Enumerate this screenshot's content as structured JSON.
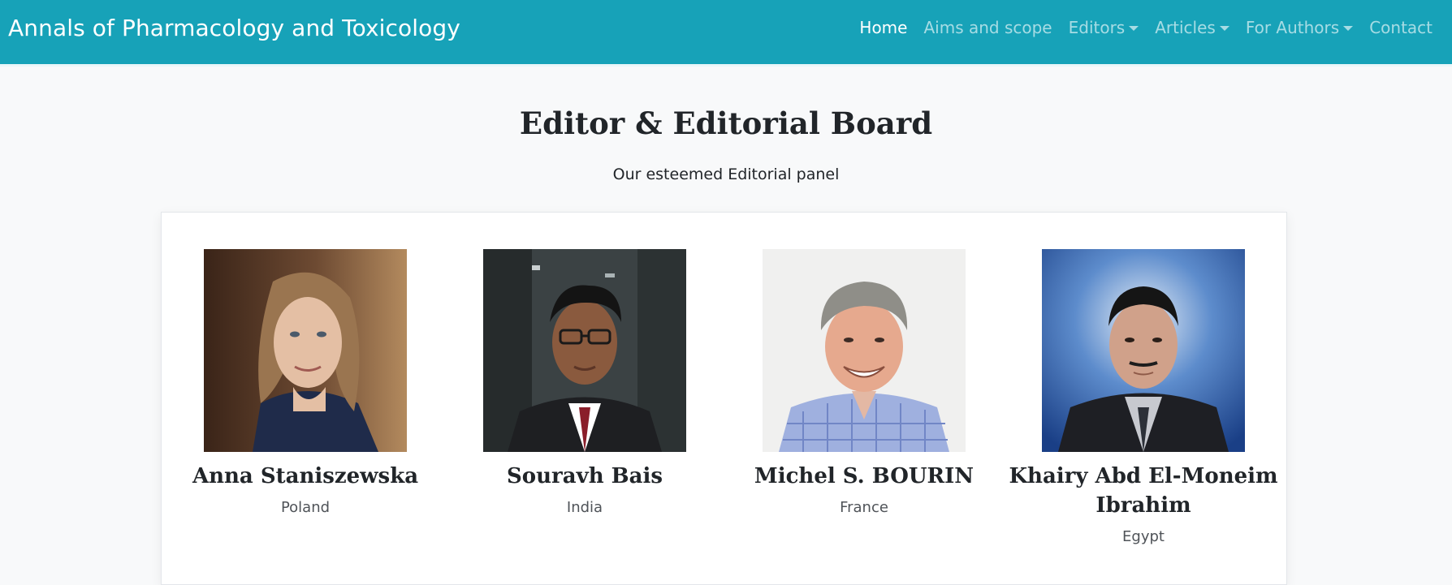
{
  "header": {
    "brand": "Annals of Pharmacology and Toxicology",
    "nav": [
      {
        "label": "Home",
        "active": true,
        "dropdown": false
      },
      {
        "label": "Aims and scope",
        "active": false,
        "dropdown": false
      },
      {
        "label": "Editors",
        "active": false,
        "dropdown": true
      },
      {
        "label": "Articles",
        "active": false,
        "dropdown": true
      },
      {
        "label": "For Authors",
        "active": false,
        "dropdown": true
      },
      {
        "label": "Contact",
        "active": false,
        "dropdown": false
      }
    ]
  },
  "section": {
    "title": "Editor & Editorial Board",
    "subtitle": "Our esteemed Editorial panel"
  },
  "members": [
    {
      "name": "Anna Staniszewska",
      "country": "Poland"
    },
    {
      "name": "Souravh Bais",
      "country": "India"
    },
    {
      "name": "Michel S. BOURIN",
      "country": "France"
    },
    {
      "name": "Khairy Abd El-Moneim Ibrahim",
      "country": "Egypt"
    }
  ],
  "colors": {
    "navbar": "#17a2b8",
    "page_background": "#f8f9fa",
    "card_background": "#ffffff"
  }
}
